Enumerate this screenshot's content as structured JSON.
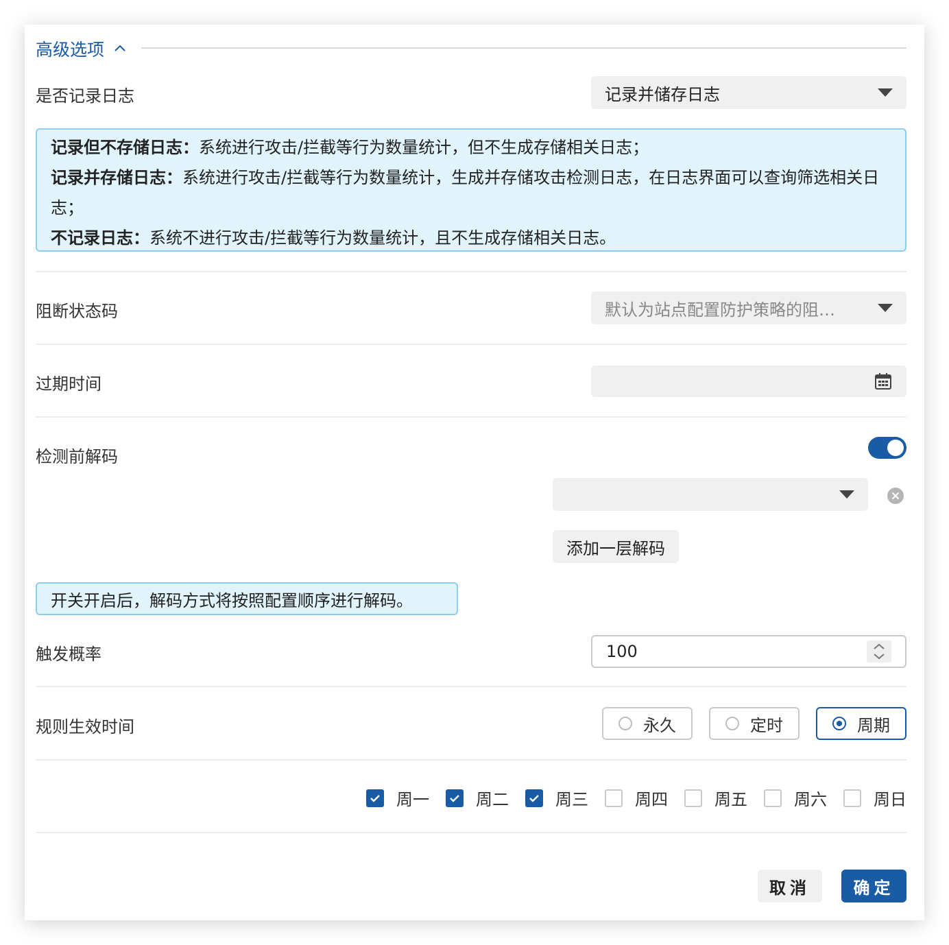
{
  "section": {
    "title": "高级选项"
  },
  "log": {
    "label": "是否记录日志",
    "selected": "记录并储存日志",
    "info": [
      {
        "term": "记录但不存储日志：",
        "desc": "系统进行攻击/拦截等行为数量统计，但不生成存储相关日志；"
      },
      {
        "term": "记录并存储日志：",
        "desc": "系统进行攻击/拦截等行为数量统计，生成并存储攻击检测日志，在日志界面可以查询筛选相关日志；"
      },
      {
        "term": "不记录日志：",
        "desc": "系统不进行攻击/拦截等行为数量统计，且不生成存储相关日志。"
      }
    ]
  },
  "block_status": {
    "label": "阻断状态码",
    "placeholder": "默认为站点配置防护策略的阻…"
  },
  "expire": {
    "label": "过期时间",
    "value": ""
  },
  "decode": {
    "label": "检测前解码",
    "enabled": true,
    "select_value": "",
    "add_layer_label": "添加一层解码",
    "tip": "开关开启后，解码方式将按照配置顺序进行解码。"
  },
  "probability": {
    "label": "触发概率",
    "value": "100"
  },
  "effective_time": {
    "label": "规则生效时间",
    "options": [
      "永久",
      "定时",
      "周期"
    ],
    "selected": "周期"
  },
  "weekdays": [
    {
      "label": "周一",
      "checked": true
    },
    {
      "label": "周二",
      "checked": true
    },
    {
      "label": "周三",
      "checked": true
    },
    {
      "label": "周四",
      "checked": false
    },
    {
      "label": "周五",
      "checked": false
    },
    {
      "label": "周六",
      "checked": false
    },
    {
      "label": "周日",
      "checked": false
    }
  ],
  "footer": {
    "cancel_label": "取消",
    "ok_label": "确定"
  },
  "colors": {
    "accent": "#1a5ba6",
    "info_bg": "#e1f4fc",
    "info_border": "#8fcdef"
  },
  "icons": [
    "chevron-up-icon",
    "dropdown-arrow-icon",
    "calendar-icon",
    "clear-circle-icon",
    "spinner-arrows-icon",
    "check-icon"
  ]
}
